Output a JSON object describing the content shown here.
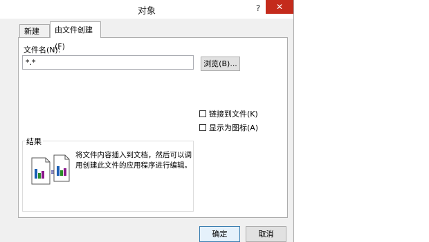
{
  "window": {
    "title": "对象",
    "help": "?",
    "close": "✕"
  },
  "tabs": {
    "new_label": "新建(C)",
    "from_file_label": "由文件创建(F)"
  },
  "filename": {
    "label": "文件名(N):",
    "value": "*.*"
  },
  "browse_button": "浏览(B)...",
  "options": {
    "link_label": "链接到文件(K)",
    "display_icon_label": "显示为图标(A)"
  },
  "result": {
    "legend": "结果",
    "text": "将文件内容插入到文档，然后可以调用创建此文件的应用程序进行编辑。"
  },
  "buttons": {
    "ok": "确定",
    "cancel": "取消"
  },
  "colors": {
    "close_bg": "#c42b1c",
    "dialog_bg": "#f0f0f0",
    "ok_border": "#3c7fb1"
  }
}
